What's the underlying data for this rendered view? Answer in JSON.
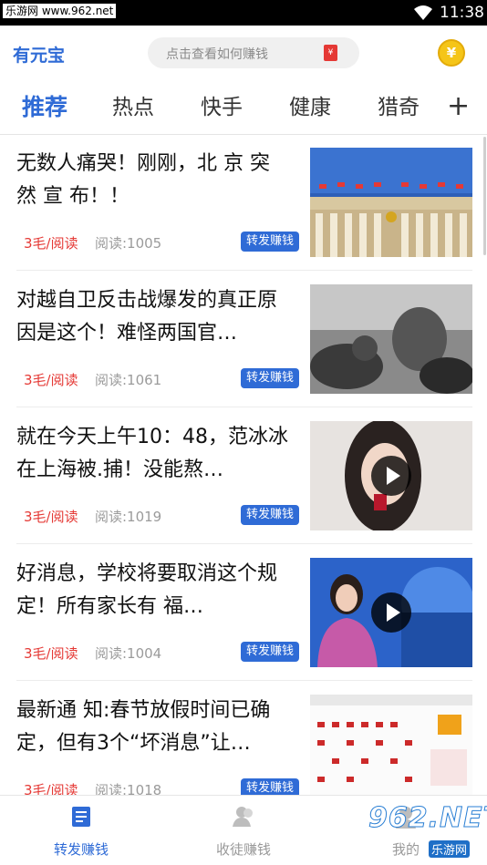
{
  "status_bar": {
    "watermark": "乐游网 www.962.net",
    "time": "11:38"
  },
  "app_bar": {
    "brand": "有元宝",
    "search_placeholder": "点击查看如何赚钱",
    "search_badge": "¥",
    "coin_symbol": "¥"
  },
  "tabs": [
    {
      "label": "推荐",
      "active": true
    },
    {
      "label": "热点",
      "active": false
    },
    {
      "label": "快手",
      "active": false
    },
    {
      "label": "健康",
      "active": false
    },
    {
      "label": "猎奇",
      "active": false
    }
  ],
  "tab_add": "+",
  "articles": [
    {
      "title": "无数人痛哭！刚刚，北 京 突 然 宣 布！！",
      "price": "3毛/阅读",
      "reads": "阅读:1005",
      "share": "转发赚钱",
      "video": false
    },
    {
      "title": "对越自卫反击战爆发的真正原因是这个！难怪两国官…",
      "price": "3毛/阅读",
      "reads": "阅读:1061",
      "share": "转发赚钱",
      "video": false
    },
    {
      "title": "就在今天上午10：48，范冰冰在上海被.捕！没能熬…",
      "price": "3毛/阅读",
      "reads": "阅读:1019",
      "share": "转发赚钱",
      "video": true
    },
    {
      "title": "好消息，学校将要取消这个规定！所有家长有 福…",
      "price": "3毛/阅读",
      "reads": "阅读:1004",
      "share": "转发赚钱",
      "video": true
    },
    {
      "title": "最新通 知:春节放假时间已确定，但有3个“坏消息”让…",
      "price": "3毛/阅读",
      "reads": "阅读:1018",
      "share": "转发赚钱",
      "video": false
    }
  ],
  "bottom_nav": [
    {
      "label": "转发赚钱",
      "active": true
    },
    {
      "label": "收徒赚钱",
      "active": false
    },
    {
      "label": "我的",
      "active": false
    }
  ],
  "corner_watermark": {
    "number": "962.NET",
    "text": "乐游网"
  },
  "colors": {
    "accent": "#2f6bd6",
    "price": "#e53935",
    "muted": "#9b9b9b"
  }
}
